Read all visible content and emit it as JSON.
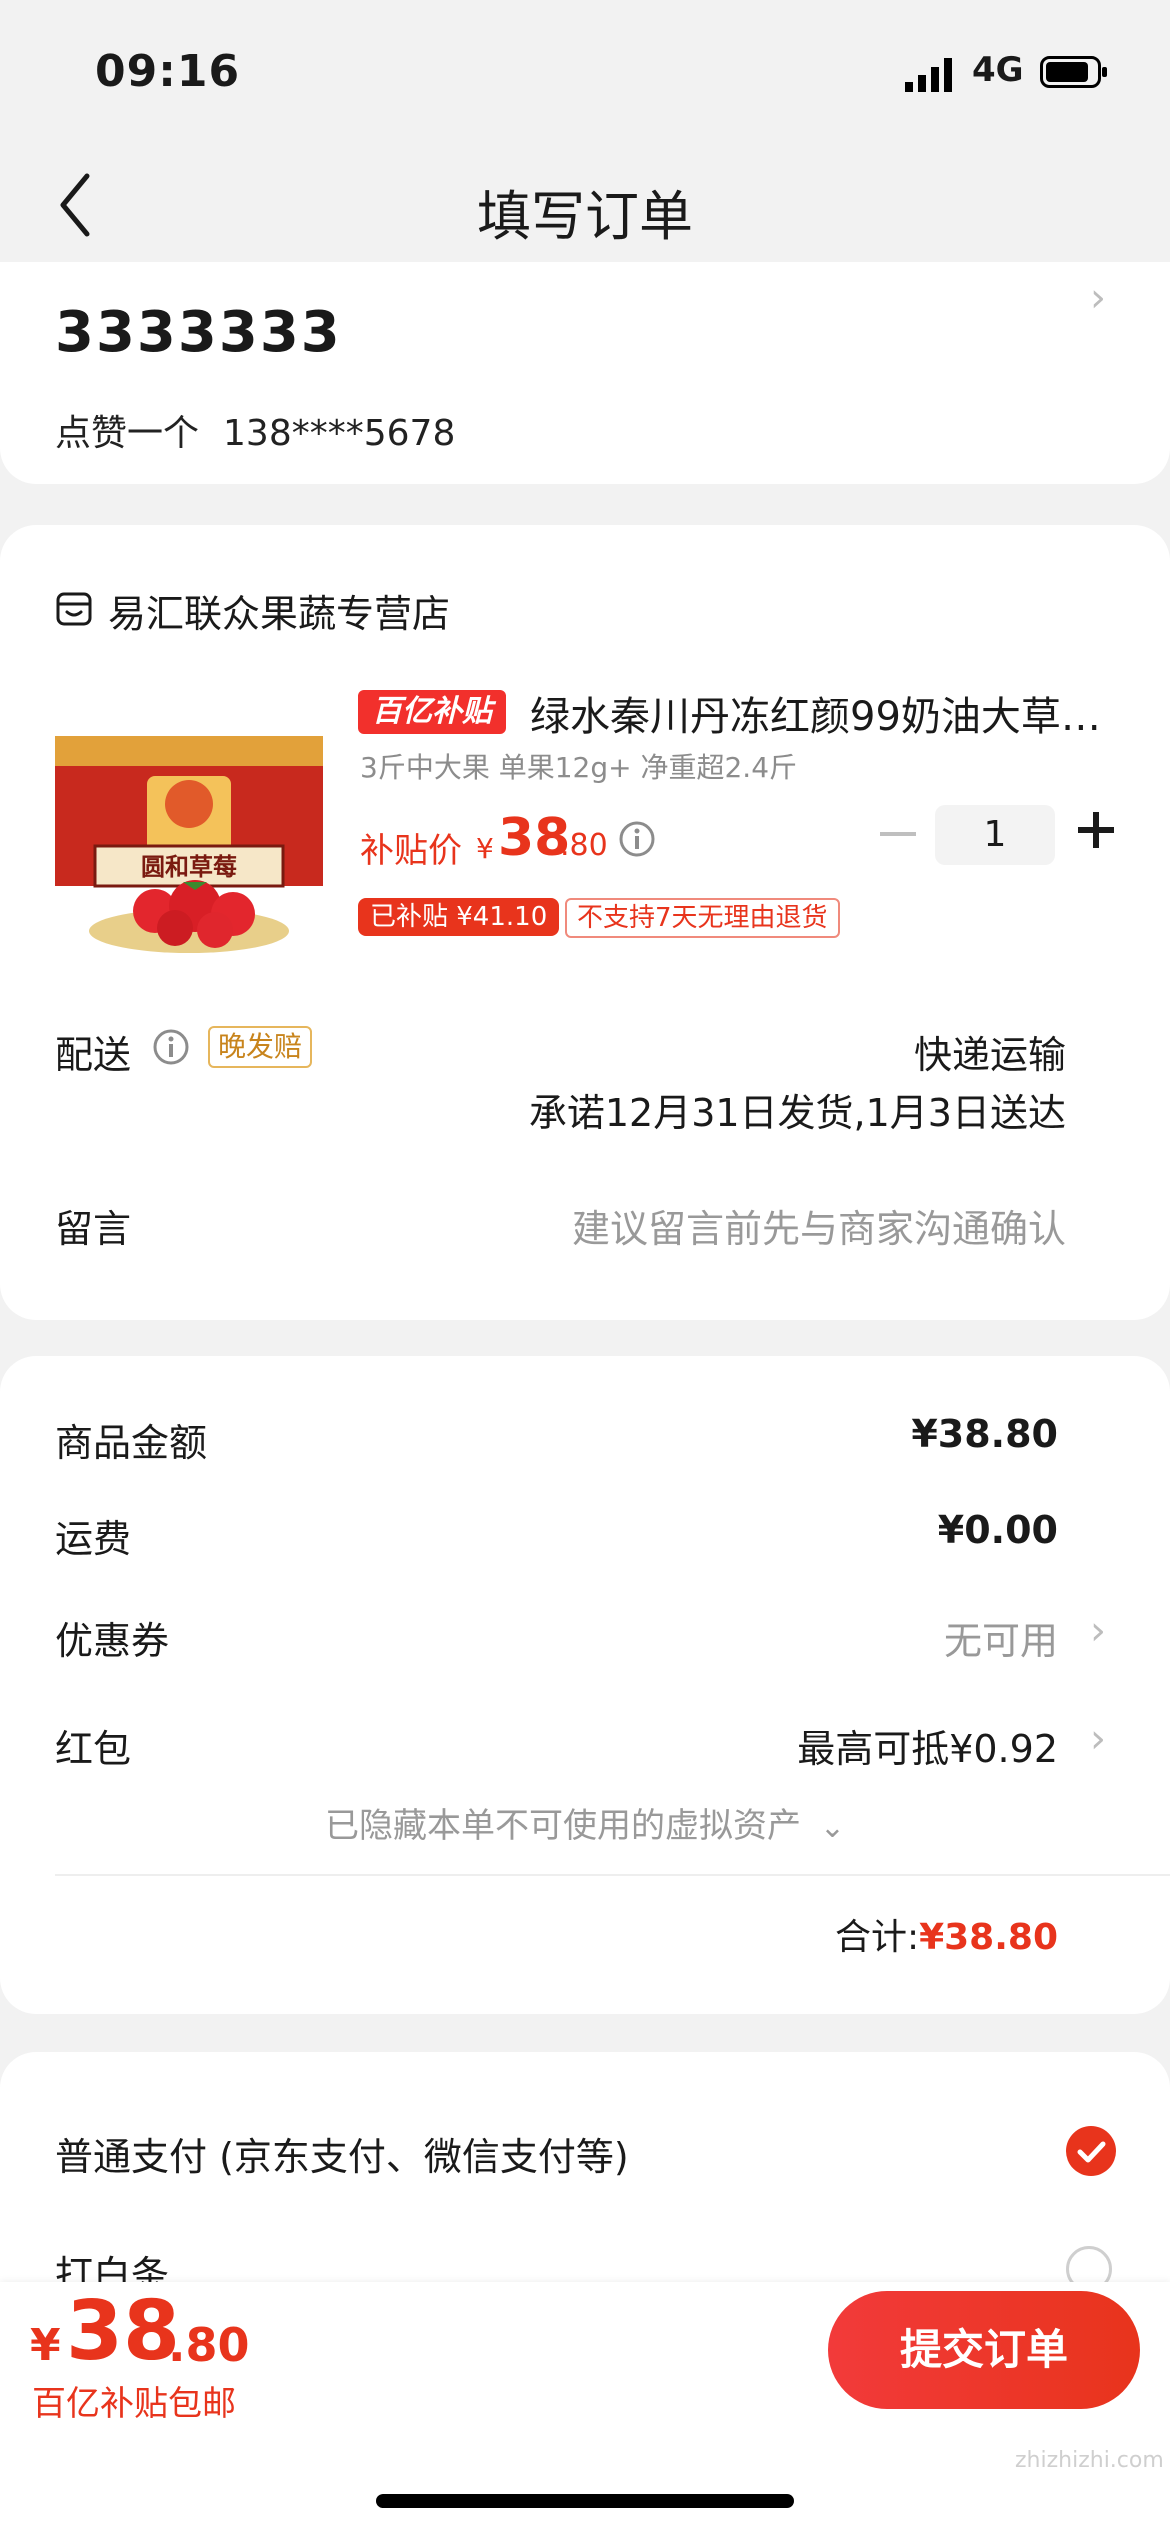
{
  "status_bar": {
    "time": "09:16",
    "network": "4G"
  },
  "nav": {
    "title": "填写订单"
  },
  "address": {
    "name": "3333333",
    "receiver": "点赞一个",
    "phone": "138****5678"
  },
  "store": {
    "name": "易汇联众果蔬专营店"
  },
  "product": {
    "badge": "百亿补贴",
    "title": "绿水秦川丹冻红颜99奶油大草…",
    "spec": "3斤中大果 单果12g+ 净重超2.4斤",
    "price_label": "补贴价",
    "price_currency": "¥",
    "price_int": "38",
    "price_dec": ".80",
    "quantity": "1",
    "tag_subsidized": "已补贴 ¥41.10",
    "tag_noreturn": "不支持7天无理由退货",
    "image_text": "圆和草莓"
  },
  "delivery": {
    "label": "配送",
    "badge": "晚发赔",
    "method": "快递运输",
    "promise": "承诺12月31日发货,1月3日送达"
  },
  "message": {
    "label": "留言",
    "placeholder": "建议留言前先与商家沟通确认"
  },
  "summary": {
    "goods_label": "商品金额",
    "goods_value": "¥38.80",
    "shipping_label": "运费",
    "shipping_value": "¥0.00",
    "coupon_label": "优惠券",
    "coupon_value": "无可用",
    "redpacket_label": "红包",
    "redpacket_value": "最高可抵¥0.92",
    "hidden_assets": "已隐藏本单不可使用的虚拟资产",
    "total_label": "合计:",
    "total_value": "¥38.80"
  },
  "payment": {
    "option1": "普通支付 (京东支付、微信支付等)",
    "option2": "打白条"
  },
  "bottom": {
    "currency": "¥",
    "price_int": "38",
    "price_dec": ".80",
    "note": "百亿补贴包邮",
    "submit": "提交订单"
  },
  "watermark": "zhizhizhi.com",
  "colors": {
    "accent": "#e8341c",
    "background": "#f2f2f2"
  }
}
